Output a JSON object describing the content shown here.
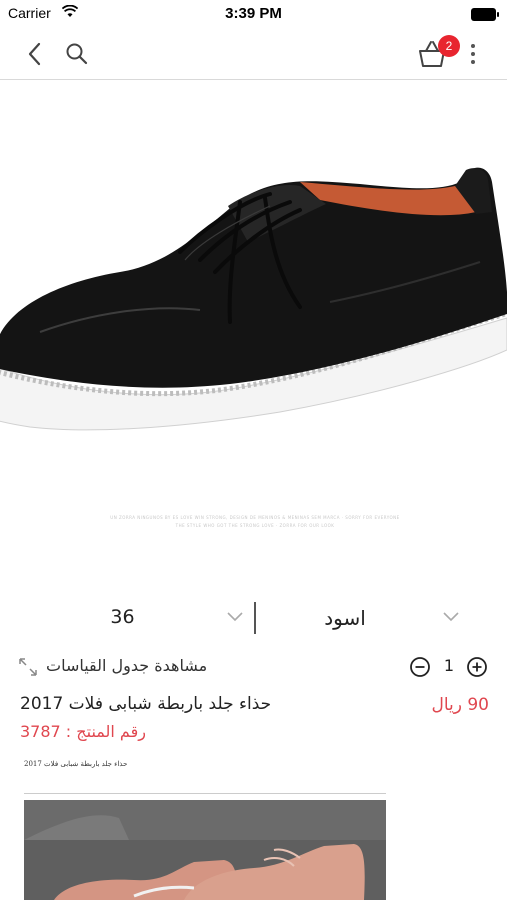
{
  "status_bar": {
    "carrier": "Carrier",
    "time": "3:39 PM"
  },
  "nav": {
    "basket_count": "2",
    "icons": [
      "back-chevron-icon",
      "search-icon",
      "basket-icon",
      "more-vertical-icon"
    ]
  },
  "product_image": {
    "caption": "UN ZORRA NINGUNOS BY ES LOVE WIN STRONG, DESIGN DE MENINOS & MENINAS SEM MARCA · SORRY FOR EVERYONE THE STYLE WHO GOT THE STRONG LOVE · ZORRA FOR OUR LOOK"
  },
  "selectors": {
    "size_value": "36",
    "color_value": "اسود"
  },
  "size_chart": {
    "label": "مشاهدة جدول القياسات"
  },
  "quantity": {
    "value": "1"
  },
  "product": {
    "title": "حذاء جلد باربطة شبابى فلات 2017",
    "price": "90 ريال",
    "number_label": "رقم المنتج : 3787",
    "description": "حذاء جلد باربطة شبابى فلات 2017"
  },
  "colors": {
    "accent_red": "#e0474f",
    "badge_red": "#e8252f",
    "divider": "#d9d9d9"
  }
}
